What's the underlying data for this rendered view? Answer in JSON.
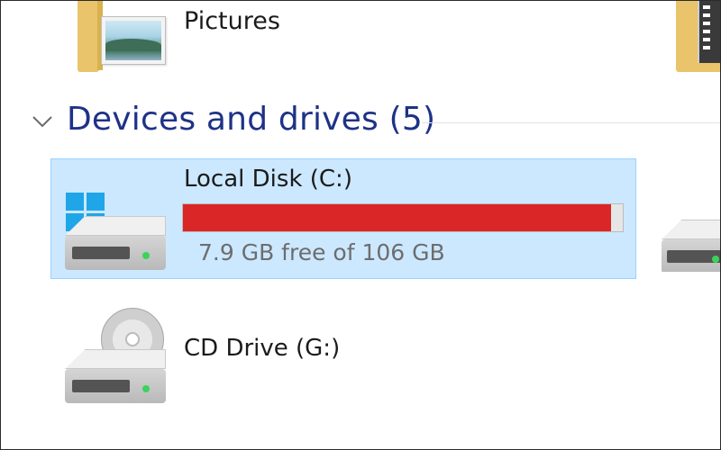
{
  "pictures_item": {
    "label": "Pictures",
    "icon": "pictures-folder-icon"
  },
  "devices_group": {
    "title": "Devices and drives (5)",
    "chevron_icon": "chevron-down-icon"
  },
  "drives": {
    "local_disk": {
      "name": "Local Disk (C:)",
      "free_text": "7.9 GB free of 106 GB",
      "used_fraction": 0.974,
      "bar_color": "#da2626",
      "selected": true,
      "icon": "windows-hard-drive-icon"
    },
    "cd_drive": {
      "name": "CD Drive (G:)",
      "icon": "cd-drive-icon"
    }
  },
  "colors": {
    "group_title": "#1e3287",
    "selection_bg": "#cce8ff",
    "selection_border": "#99d1ff",
    "windows_blue": "#1fa6e8"
  }
}
